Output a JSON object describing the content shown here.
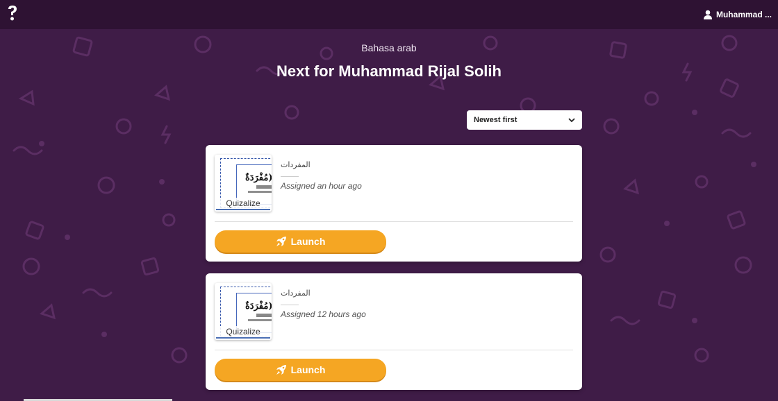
{
  "header": {
    "logo_icon": "quizizz-question-logo-icon",
    "user_icon": "user-icon",
    "user_name": "Muhammad ..."
  },
  "page": {
    "subtitle": "Bahasa arab",
    "title": "Next for Muhammad Rijal Solih"
  },
  "sort": {
    "selected": "Newest first",
    "icon": "chevron-down-icon"
  },
  "cards": [
    {
      "thumb_label": "Quizalize",
      "quiz_name": "المفردات",
      "assigned": "Assigned an hour ago",
      "launch_label": "Launch",
      "launch_icon": "rocket-icon"
    },
    {
      "thumb_label": "Quizalize",
      "quiz_name": "المفردات",
      "assigned": "Assigned 12 hours ago",
      "launch_label": "Launch",
      "launch_icon": "rocket-icon"
    }
  ],
  "colors": {
    "background": "#3f1c47",
    "topbar": "#2e1233",
    "launch_button": "#f5a623"
  }
}
